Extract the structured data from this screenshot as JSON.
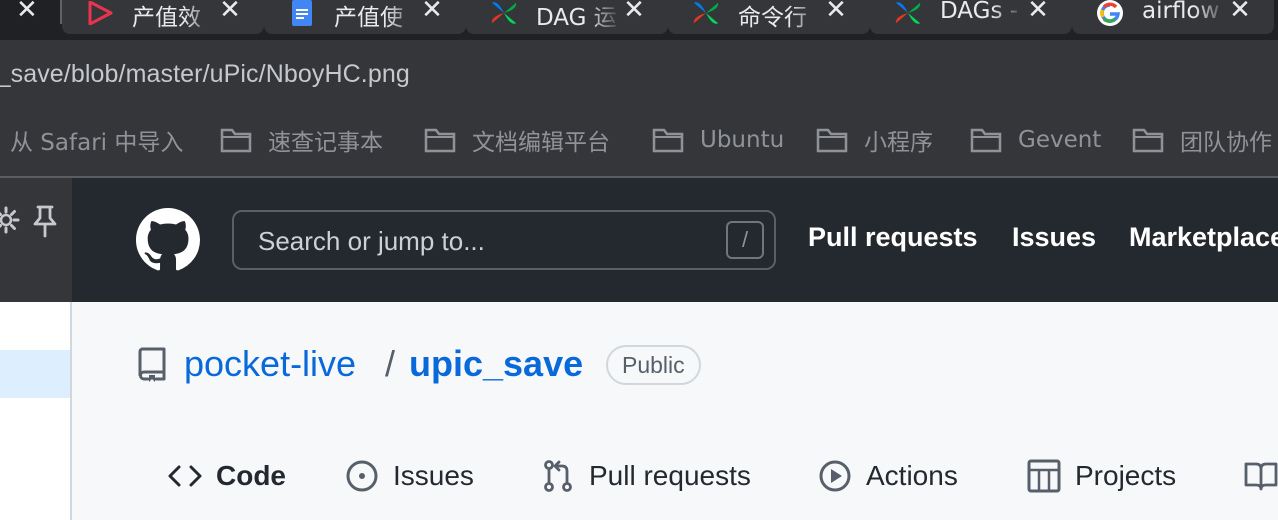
{
  "browser": {
    "tabs": [
      {
        "title": "产值效",
        "icon": "play-triangle-icon",
        "color": "#e8344e"
      },
      {
        "title": "产值使",
        "icon": "google-docs-icon",
        "color": "#4285f4"
      },
      {
        "title": "DAG 运",
        "icon": "airflow-pinwheel-icon"
      },
      {
        "title": "命令行",
        "icon": "airflow-pinwheel-icon"
      },
      {
        "title": "DAGs -",
        "icon": "airflow-pinwheel-icon"
      },
      {
        "title": "airflow",
        "icon": "google-g-icon"
      }
    ],
    "close_glyph": "✕",
    "url": "c_save/blob/master/uPic/NboyHC.png",
    "bookmarks": [
      {
        "label": "从 Safari 中导入",
        "folder": false
      },
      {
        "label": "速查记事本",
        "folder": true
      },
      {
        "label": "文档编辑平台",
        "folder": true
      },
      {
        "label": "Ubuntu",
        "folder": true
      },
      {
        "label": "小程序",
        "folder": true
      },
      {
        "label": "Gevent",
        "folder": true
      },
      {
        "label": "团队协作",
        "folder": true
      }
    ]
  },
  "github": {
    "search_placeholder": "Search or jump to...",
    "search_shortcut": "/",
    "nav": [
      "Pull requests",
      "Issues",
      "Marketplace"
    ]
  },
  "repo": {
    "owner": "pocket-live",
    "separator": "/",
    "name": "upic_save",
    "visibility": "Public",
    "tabs": [
      {
        "label": "Code",
        "icon": "code-icon",
        "selected": true
      },
      {
        "label": "Issues",
        "icon": "issue-circle-icon",
        "selected": false
      },
      {
        "label": "Pull requests",
        "icon": "pull-request-icon",
        "selected": false
      },
      {
        "label": "Actions",
        "icon": "play-circle-icon",
        "selected": false
      },
      {
        "label": "Projects",
        "icon": "table-icon",
        "selected": false
      },
      {
        "label": "",
        "icon": "book-icon",
        "selected": false
      }
    ]
  },
  "colors": {
    "link": "#0969da",
    "header_bg": "#24292f",
    "chrome_bg": "#35363a"
  }
}
